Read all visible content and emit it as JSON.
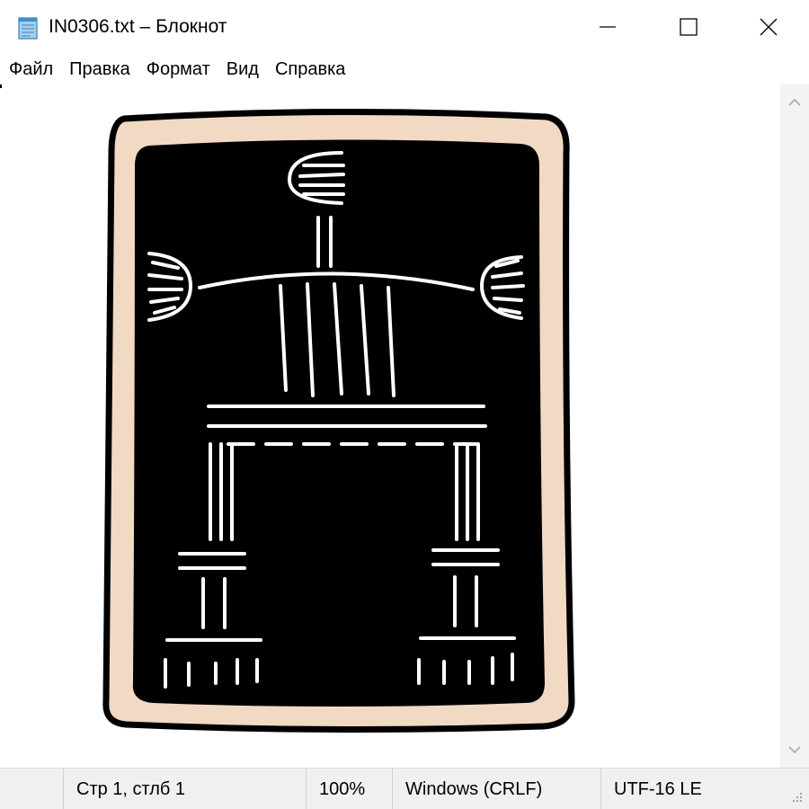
{
  "window": {
    "title": "IN0306.txt – Блокнот"
  },
  "menu": {
    "items": [
      "Файл",
      "Правка",
      "Формат",
      "Вид",
      "Справка"
    ]
  },
  "status": {
    "position": "Стр 1, стлб 1",
    "zoom": "100%",
    "line_endings": "Windows (CRLF)",
    "encoding": "UTF-16 LE"
  },
  "colors": {
    "frame_fill": "#f1d9c4",
    "panel_fill": "#000000",
    "line_color": "#ffffff"
  },
  "icons": {
    "app": "notepad-icon",
    "minimize": "minimize-icon",
    "maximize": "maximize-icon",
    "close": "close-icon",
    "scroll_up": "chevron-up-icon",
    "scroll_down": "chevron-down-icon",
    "resize": "resize-grip-icon"
  }
}
